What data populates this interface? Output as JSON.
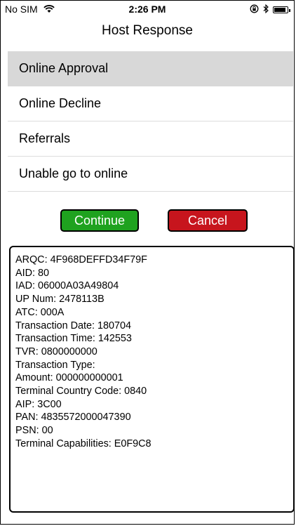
{
  "status_bar": {
    "carrier": "No SIM",
    "time": "2:26 PM",
    "battery_level": 0.9
  },
  "nav": {
    "title": "Host Response"
  },
  "options": [
    {
      "label": "Online Approval",
      "selected": true
    },
    {
      "label": "Online Decline",
      "selected": false
    },
    {
      "label": "Referrals",
      "selected": false
    },
    {
      "label": "Unable go to online",
      "selected": false
    }
  ],
  "buttons": {
    "continue_label": "Continue",
    "cancel_label": "Cancel",
    "continue_color": "#1fa21f",
    "cancel_color": "#c7151d"
  },
  "log": [
    "ARQC: 4F968DEFFD34F79F",
    "AID: 80",
    "IAD: 06000A03A49804",
    "UP Num: 2478113B",
    "ATC: 000A",
    "Transaction Date: 180704",
    "Transaction Time: 142553",
    "TVR: 0800000000",
    "Transaction Type:",
    "Amount: 000000000001",
    "Terminal Country Code: 0840",
    "AIP: 3C00",
    "PAN: 4835572000047390",
    "PSN: 00",
    "Terminal Capabilities: E0F9C8"
  ]
}
